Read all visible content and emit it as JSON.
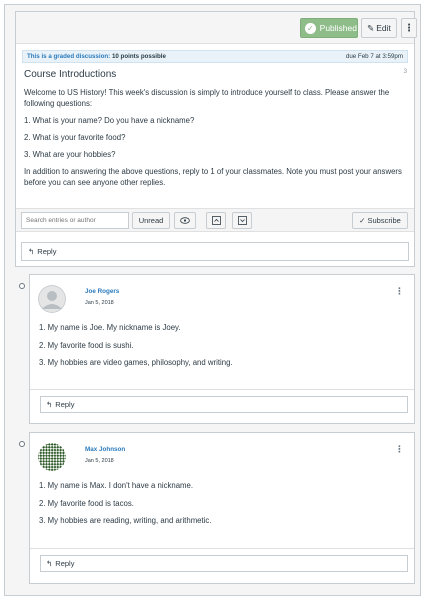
{
  "toolbar": {
    "published_label": "Published",
    "edit_label": "Edit",
    "more_icon": "kebab-menu-icon"
  },
  "graded": {
    "label": "This is a graded discussion:",
    "points": "10 points possible",
    "due": "due Feb 7 at 3:59pm"
  },
  "topic": {
    "title": "Course Introductions",
    "badge": "3",
    "paragraphs": [
      "Welcome to US History! This week's discussion is simply to introduce yourself to class. Please answer the following questions:",
      "1. What is your name? Do you have a nickname?",
      "2. What is your favorite food?",
      "3. What are your hobbies?",
      "In addition to answering the above questions, reply to 1 of your classmates. Note you must post your answers before you can see anyone other replies."
    ]
  },
  "filter": {
    "search_placeholder": "Search entries or author",
    "unread_label": "Unread",
    "subscribe_label": "Subscribe"
  },
  "reply_label": "Reply",
  "entries": [
    {
      "author": "Joe Rogers",
      "date": "Jan 5, 2018",
      "lines": [
        "1. My name is Joe. My nickname is Joey.",
        "2. My favorite food is sushi.",
        "3. My hobbies are video games, philosophy, and writing."
      ],
      "reply_label": "Reply"
    },
    {
      "author": "Max Johnson",
      "date": "Jan 5, 2018",
      "lines": [
        "1. My name is Max. I don't have a nickname.",
        "2. My favorite food is tacos.",
        "3. My hobbies are reading, writing, and arithmetic."
      ],
      "reply_label": "Reply"
    }
  ]
}
